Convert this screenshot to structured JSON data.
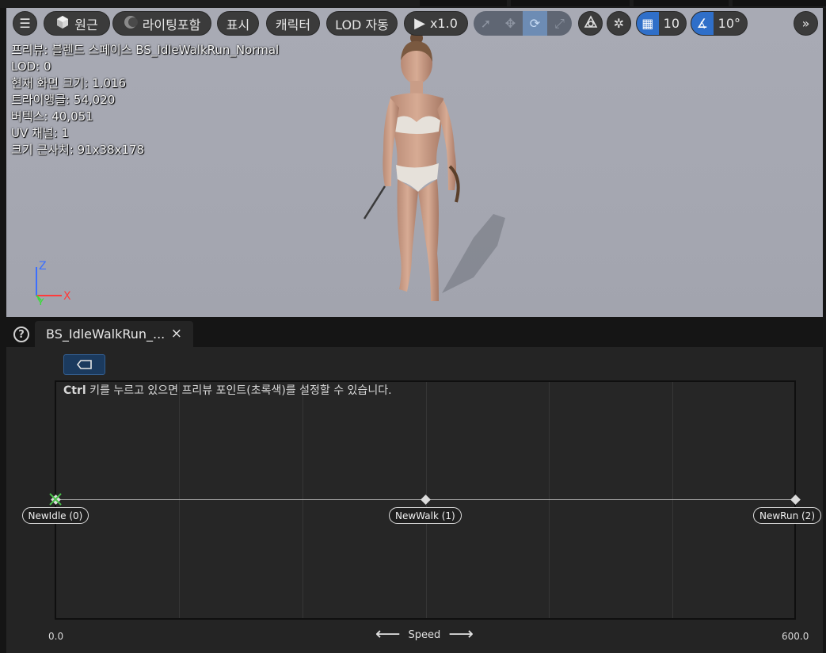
{
  "toolbar": {
    "perspective_label": "원근",
    "lighting_label": "라이팅포함",
    "show_label": "표시",
    "character_label": "캐릭터",
    "lod_label": "LOD 자동",
    "play_rate_label": "x1.0",
    "grid_snap_value": "10",
    "rotation_snap_value": "10°"
  },
  "stats": {
    "preview": "프리뷰: 블렌드 스페이스 BS_IdleWalkRun_Normal",
    "lod": "LOD: 0",
    "screen_size": "현재 화면 크기: 1.016",
    "triangles": "트라이앵글: 54,020",
    "vertices": "버텍스: 40,051",
    "uv_channels": "UV 채널: 1",
    "approx_size": "크기 근사치: 91x38x178"
  },
  "axes_gizmo": {
    "z": "Z",
    "x": "X",
    "y": "Y"
  },
  "tab": {
    "title": "BS_IdleWalkRun_...",
    "close": "×"
  },
  "blendspace": {
    "hint_bold": "Ctrl",
    "hint_rest": " 키를 누르고 있으면 프리뷰 포인트(초록색)를 설정할 수 있습니다.",
    "axis_min": "0.0",
    "axis_max": "600.0",
    "axis_name": "Speed",
    "samples": [
      {
        "label": "NewIdle (0)",
        "value": 0
      },
      {
        "label": "NewWalk (1)",
        "value": 300
      },
      {
        "label": "NewRun (2)",
        "value": 600
      }
    ],
    "preview_point": 0
  },
  "colors": {
    "accent": "#2f6fc9",
    "snap_active": "#2f6fc9"
  }
}
